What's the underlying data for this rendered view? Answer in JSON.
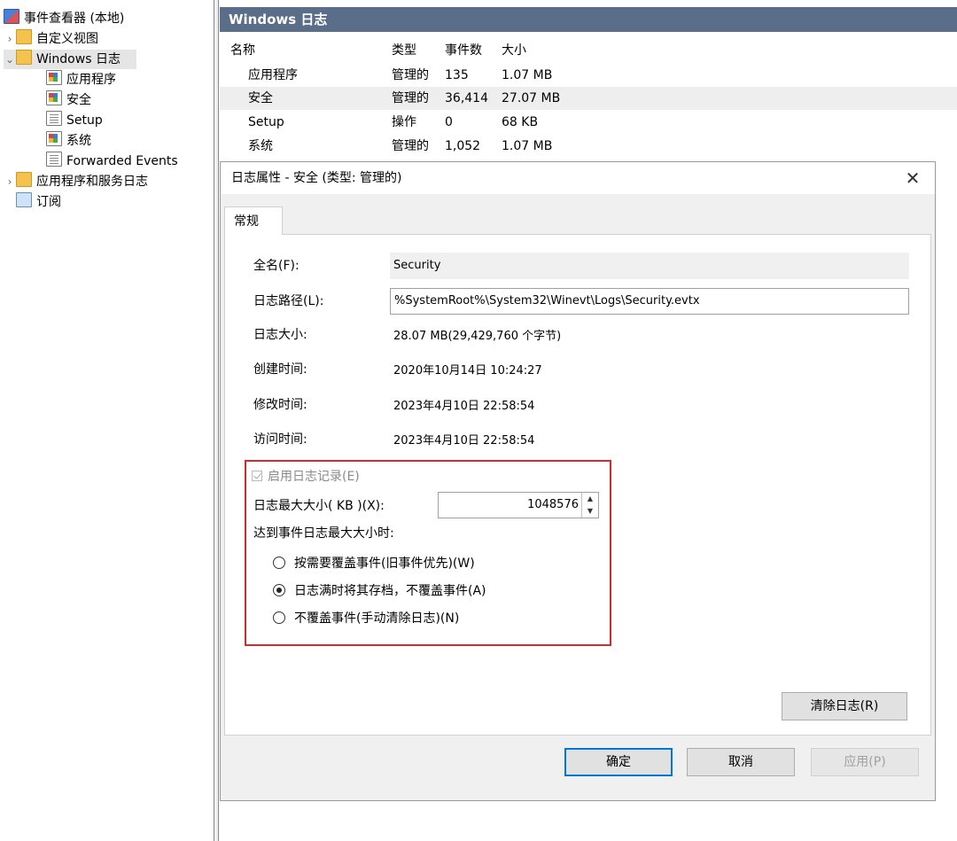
{
  "tree": {
    "root_label": "事件查看器 (本地)",
    "items": [
      {
        "label": "自定义视图",
        "expander": "›"
      },
      {
        "label": "Windows 日志",
        "expander": "⌄"
      },
      {
        "label": "应用程序"
      },
      {
        "label": "安全"
      },
      {
        "label": "Setup"
      },
      {
        "label": "系统"
      },
      {
        "label": "Forwarded Events"
      },
      {
        "label": "应用程序和服务日志",
        "expander": "›"
      },
      {
        "label": "订阅"
      }
    ]
  },
  "pane": {
    "title": "Windows 日志",
    "columns": [
      "名称",
      "类型",
      "事件数",
      "大小"
    ],
    "rows": [
      [
        "应用程序",
        "管理的",
        "135",
        "1.07 MB"
      ],
      [
        "安全",
        "管理的",
        "36,414",
        "27.07 MB"
      ],
      [
        "Setup",
        "操作",
        "0",
        "68 KB"
      ],
      [
        "系统",
        "管理的",
        "1,052",
        "1.07 MB"
      ]
    ]
  },
  "dialog": {
    "title": "日志属性 - 安全 (类型: 管理的)",
    "close_glyph": "✕",
    "tab_label": "常规",
    "fields": {
      "full_name_label": "全名(F):",
      "full_name_value": "Security",
      "path_label": "日志路径(L):",
      "path_value": "%SystemRoot%\\System32\\Winevt\\Logs\\Security.evtx",
      "size_label": "日志大小:",
      "size_value": "28.07 MB(29,429,760 个字节)",
      "created_label": "创建时间:",
      "created_value": "2020年10月14日 10:24:27",
      "modified_label": "修改时间:",
      "modified_value": "2023年4月10日 22:58:54",
      "accessed_label": "访问时间:",
      "accessed_value": "2023年4月10日 22:58:54"
    },
    "enable_logging_label": "启用日志记录(E)",
    "enable_logging_checked": true,
    "max_size_label": "日志最大大小( KB )(X):",
    "max_size_value": "1048576",
    "spin_up": "▲",
    "spin_down": "▼",
    "when_full_label": "达到事件日志最大大小时:",
    "options": [
      {
        "label": "按需要覆盖事件(旧事件优先)(W)",
        "selected": false
      },
      {
        "label": "日志满时将其存档，不覆盖事件(A)",
        "selected": true
      },
      {
        "label": "不覆盖事件(手动清除日志)(N)",
        "selected": false
      }
    ],
    "clear_log_label": "清除日志(R)",
    "ok_label": "确定",
    "cancel_label": "取消",
    "apply_label": "应用(P)"
  },
  "colors": {
    "header_bar": "#5a6e8a",
    "highlight_box": "#d42a2a",
    "primary_border": "#0078d7"
  }
}
